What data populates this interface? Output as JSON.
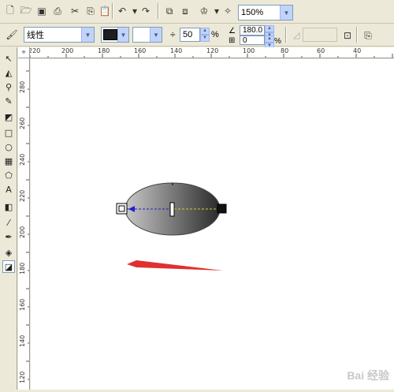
{
  "toolbar1": {
    "icons": [
      "new-icon",
      "open-icon",
      "save-icon",
      "print-icon",
      "cut-icon",
      "copy-icon",
      "paste-icon",
      "undo-icon",
      "redo-icon",
      "import-icon",
      "export-icon",
      "app-launcher-icon",
      "welcome-icon"
    ],
    "zoom_value": "150%"
  },
  "toolbar2": {
    "fill_type": "线性",
    "midpoint_value": "50",
    "midpoint_unit": "%",
    "angle_value": "180.0",
    "edge_pad_value": "0",
    "edge_pad_unit": "%",
    "first_color": "#1e1e1e"
  },
  "hruler": {
    "labels": [
      "220",
      "200",
      "180",
      "160",
      "140",
      "120",
      "100",
      "80",
      "60",
      "40"
    ]
  },
  "vruler": {
    "labels": [
      "280",
      "260",
      "240",
      "220",
      "200",
      "180",
      "160",
      "140",
      "120"
    ]
  },
  "watermark": "Bai 经验",
  "colors": {
    "gradient_start": "#c8c8c8",
    "gradient_end": "#2a2a2a",
    "arrow_red": "#e03030",
    "vector_blue": "#2020d0"
  }
}
